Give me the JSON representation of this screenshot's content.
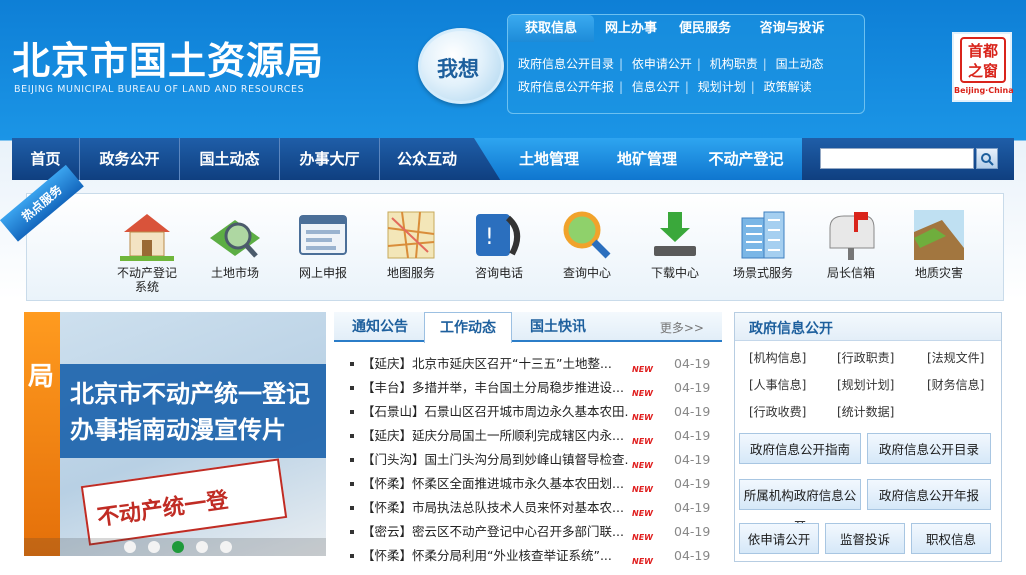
{
  "header": {
    "title": "北京市国土资源局",
    "subtitle": "BEIJING MUNICIPAL BUREAU OF LAND AND RESOURCES",
    "wo_xiang": "我想",
    "quick_tabs": [
      "获取信息",
      "网上办事",
      "便民服务",
      "咨询与投诉"
    ],
    "quick_links_row1": [
      "政府信息公开目录",
      "依申请公开",
      "机构职责",
      "国土动态"
    ],
    "quick_links_row2": [
      "政府信息公开年报",
      "信息公开",
      "规划计划",
      "政策解读"
    ],
    "city_logo_text": "首都之窗",
    "city_logo_caption": "Beijing·China"
  },
  "nav": {
    "items": [
      "首页",
      "政务公开",
      "国土动态",
      "办事大厅",
      "公众互动"
    ],
    "highlight_items": [
      "土地管理",
      "地矿管理",
      "不动产登记"
    ],
    "search_placeholder": "",
    "search_icon": "search-icon"
  },
  "hot_services": {
    "ribbon": "热点服务",
    "items": [
      {
        "label": "不动产登记\n系统",
        "icon": "house-icon"
      },
      {
        "label": "土地市场",
        "icon": "land-magnifier-icon"
      },
      {
        "label": "网上申报",
        "icon": "online-form-icon"
      },
      {
        "label": "地图服务",
        "icon": "map-icon"
      },
      {
        "label": "咨询电话",
        "icon": "phone-icon"
      },
      {
        "label": "查询中心",
        "icon": "query-magnifier-icon"
      },
      {
        "label": "下载中心",
        "icon": "download-icon"
      },
      {
        "label": "场景式服务",
        "icon": "building-icon"
      },
      {
        "label": "局长信箱",
        "icon": "mailbox-icon"
      },
      {
        "label": "地质灾害",
        "icon": "landslide-icon"
      }
    ]
  },
  "carousel": {
    "side_text": "局",
    "line1": "北京市不动产统一登记",
    "line2": "办事指南动漫宣传片",
    "card_text": "不动产统一登",
    "dots": 5,
    "active_dot": 2
  },
  "news": {
    "tabs": [
      "通知公告",
      "工作动态",
      "国土快讯"
    ],
    "active_tab": 1,
    "more": "更多>>",
    "new_badge": "NEW",
    "items": [
      {
        "text": "【延庆】北京市延庆区召开“十三五”土地整...",
        "date": "04-19"
      },
      {
        "text": "【丰台】多措并举，丰台国土分局稳步推进设...",
        "date": "04-19"
      },
      {
        "text": "【石景山】石景山区召开城市周边永久基本农田...",
        "date": "04-19"
      },
      {
        "text": "【延庆】延庆分局国土一所顺利完成辖区内永...",
        "date": "04-19"
      },
      {
        "text": "【门头沟】国土门头沟分局到妙峰山镇督导检查...",
        "date": "04-19"
      },
      {
        "text": "【怀柔】怀柔区全面推进城市永久基本农田划...",
        "date": "04-19"
      },
      {
        "text": "【怀柔】市局执法总队技术人员来怀对基本农...",
        "date": "04-19"
      },
      {
        "text": "【密云】密云区不动产登记中心召开多部门联...",
        "date": "04-19"
      },
      {
        "text": "【怀柔】怀柔分局利用“外业核查举证系统”...",
        "date": "04-19"
      }
    ]
  },
  "gov": {
    "title": "政府信息公开",
    "links": [
      "[机构信息]",
      "[行政职责]",
      "[法规文件]",
      "[人事信息]",
      "[规划计划]",
      "[财务信息]",
      "[行政收费]",
      "[统计数据]"
    ],
    "buttons": [
      "政府信息公开指南",
      "政府信息公开目录",
      "所属机构政府信息公开",
      "政府信息公开年报",
      "依申请公开",
      "监督投诉",
      "职权信息"
    ]
  },
  "colors": {
    "brand_blue": "#0e7fd6",
    "nav_dark": "#0f3f80",
    "accent_orange": "#e46f09",
    "new_red": "#e02020"
  }
}
